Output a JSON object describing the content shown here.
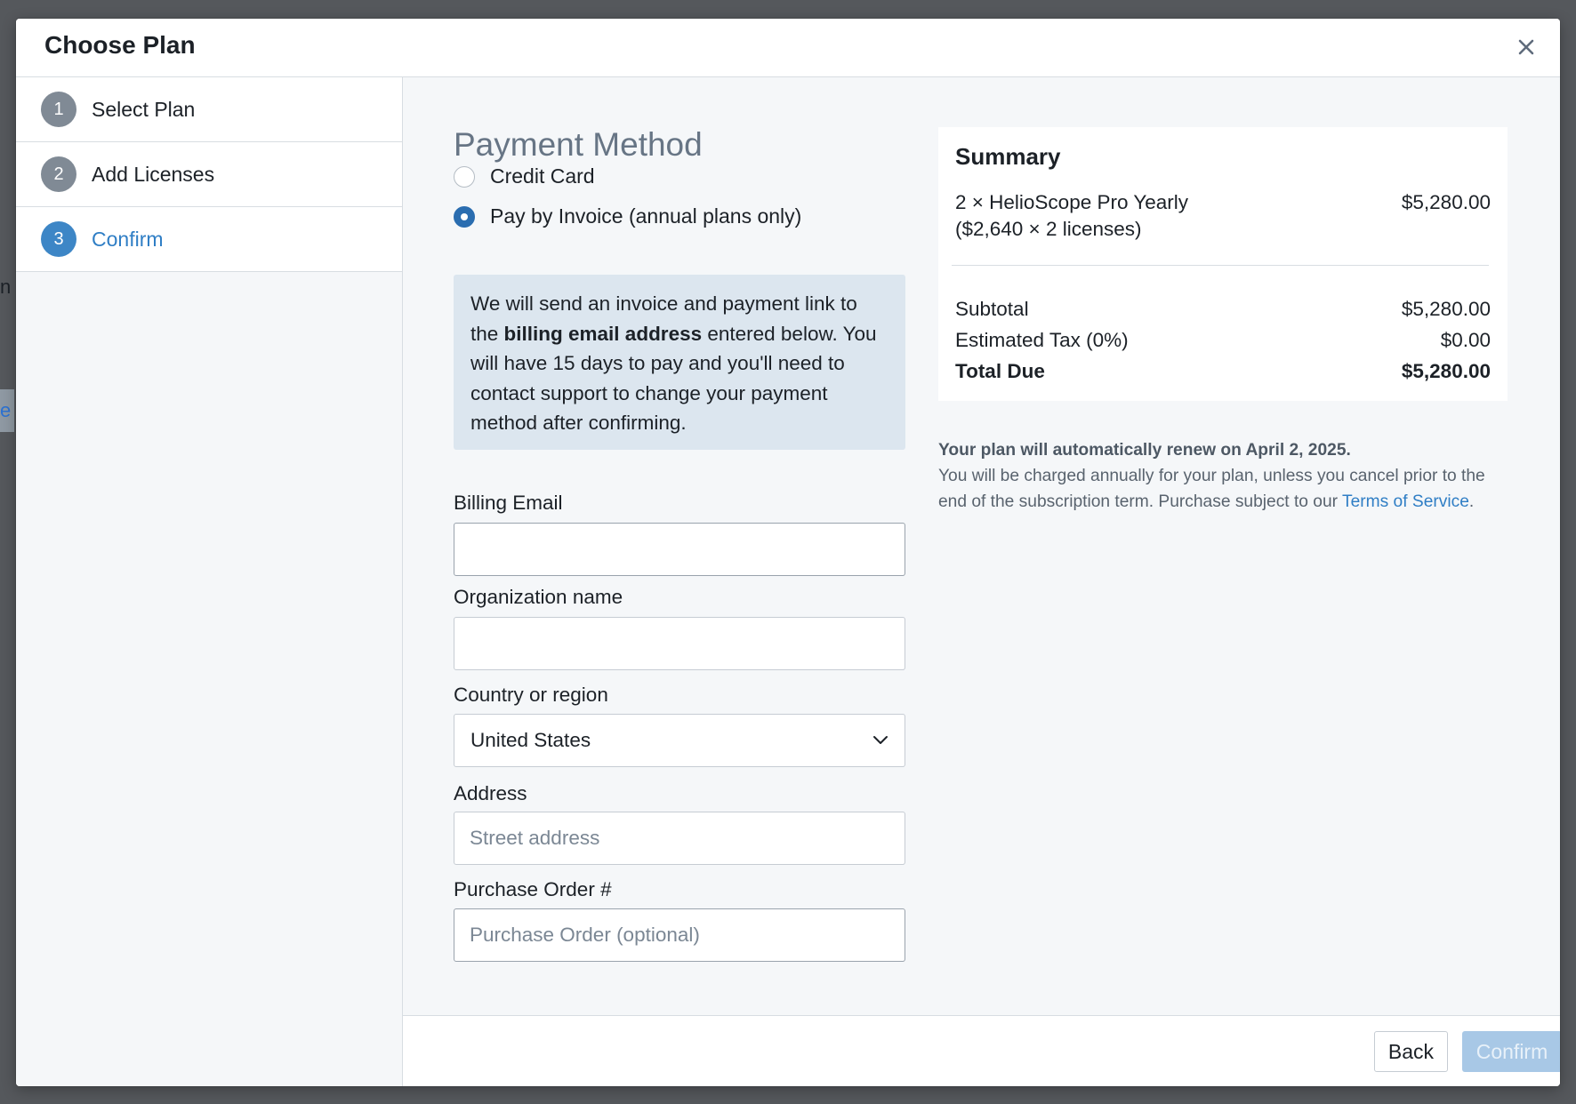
{
  "background": {
    "fragment_1": "n",
    "fragment_2": "e"
  },
  "modal": {
    "title": "Choose Plan",
    "close_icon": "close-icon"
  },
  "steps": [
    {
      "number": "1",
      "label": "Select Plan",
      "active": false
    },
    {
      "number": "2",
      "label": "Add Licenses",
      "active": false
    },
    {
      "number": "3",
      "label": "Confirm",
      "active": true
    }
  ],
  "payment": {
    "section_title": "Payment Method",
    "options": [
      {
        "label": "Credit Card",
        "checked": false
      },
      {
        "label": "Pay by Invoice (annual plans only)",
        "checked": true
      }
    ],
    "callout": {
      "text_1": "We will send an invoice and payment link to the ",
      "text_bold": "billing email address",
      "text_2": " entered below. You will have 15 days to pay and you'll need to contact support to change your payment method after confirming."
    }
  },
  "form": {
    "billing_email": {
      "label": "Billing Email",
      "value": "",
      "placeholder": ""
    },
    "organization": {
      "label": "Organization name",
      "value": "",
      "placeholder": ""
    },
    "country": {
      "label": "Country or region",
      "value": "United States"
    },
    "address": {
      "label": "Address",
      "value": "",
      "placeholder": "Street address"
    },
    "purchase_order": {
      "label": "Purchase Order #",
      "value": "",
      "placeholder": "Purchase Order (optional)"
    }
  },
  "summary": {
    "title": "Summary",
    "item_line": "2 × HelioScope Pro Yearly",
    "item_sub": "($2,640 × 2 licenses)",
    "item_amount": "$5,280.00",
    "subtotal_label": "Subtotal",
    "subtotal_amount": "$5,280.00",
    "tax_label": "Estimated Tax (0%)",
    "tax_amount": "$0.00",
    "total_label": "Total Due",
    "total_amount": "$5,280.00"
  },
  "renewal": {
    "strong": "Your plan will automatically renew on April 2, 2025.",
    "body": "You will be charged annually for your plan, unless you cancel prior to the end of the subscription term. Purchase subject to our ",
    "link": "Terms of Service",
    "end": "."
  },
  "footer": {
    "back_label": "Back",
    "confirm_label": "Confirm"
  },
  "colors": {
    "accent": "#2f7ec5",
    "step_inactive": "#808a95",
    "confirm_disabled": "#a8c8e6",
    "callout_bg": "#dce6ef"
  }
}
